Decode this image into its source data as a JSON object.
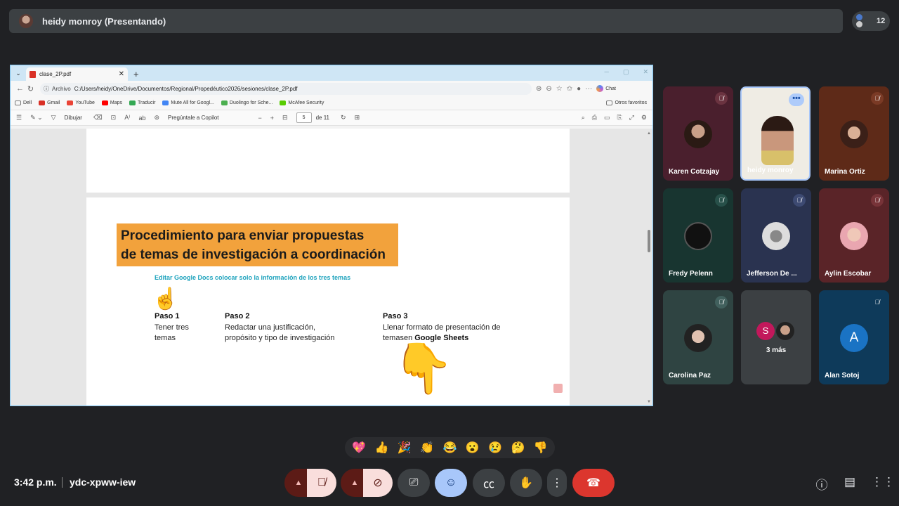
{
  "presenter": {
    "name": "heidy monroy (Presentando)",
    "participant_count": "12"
  },
  "browser": {
    "tab_title": "clase_2P.pdf",
    "address_label": "Archivo",
    "address_path": "C:/Users/heidy/OneDrive/Documentos/Regional/Propedéutico2026/sesiones/clase_2P.pdf",
    "chat_label": "Chat",
    "bookmarks": [
      "Dell",
      "Gmail",
      "YouTube",
      "Maps",
      "Traducir",
      "Mute All for Googl...",
      "Duolingo for Sche...",
      "McAfee Security"
    ],
    "bookmark_colors": [
      "#777777",
      "#d93025",
      "#ea4335",
      "#ff0000",
      "#34a853",
      "#4285f4",
      "#4caf50",
      "#58cc02",
      "#c01818"
    ],
    "other_bookmarks": "Otros favoritos",
    "toolbar": {
      "draw_label": "Dibujar",
      "copilot_label": "Pregúntale a Copilot",
      "page_current": "5",
      "page_total": "de 11"
    }
  },
  "slide": {
    "title_line1": "Procedimiento para enviar propuestas",
    "title_line2": "de temas de investigación a coordinación",
    "subtitle": "Editar Google Docs colocar solo la información de los tres temas",
    "paso1": {
      "heading": "Paso 1",
      "line1": "Tener tres",
      "line2": "temas"
    },
    "paso2": {
      "heading": "Paso 2",
      "line1": "Redactar una justificación,",
      "line2": "propósito y tipo de investigación"
    },
    "paso3": {
      "heading": "Paso 3",
      "line1": "Llenar formato de presentación de",
      "line2_prefix": "temasen ",
      "line2_bold": "Google Sheets"
    }
  },
  "participants": [
    {
      "name": "Karen Cotzajay",
      "bg": "#4a1f2d",
      "mic": "off"
    },
    {
      "name": "heidy monroy",
      "bg": "#f2f0ea",
      "mic": "on"
    },
    {
      "name": "Marina Ortiz",
      "bg": "#5e2a18",
      "mic": "off"
    },
    {
      "name": "Fredy Pelenn",
      "bg": "#183530",
      "mic": "off"
    },
    {
      "name": "Jefferson De ...",
      "bg": "#2a3350",
      "mic": "off"
    },
    {
      "name": "Aylin Escobar",
      "bg": "#5a2428",
      "mic": "off"
    },
    {
      "name": "Carolina Paz",
      "bg": "#2f4442",
      "mic": "off"
    },
    {
      "name": "3 más",
      "bg": "#3c4043",
      "mic": "none"
    },
    {
      "name": "Alan Sotoj",
      "bg": "#0e3a5a",
      "mic": "off"
    }
  ],
  "more_tile": {
    "initial": "S"
  },
  "alan_initial": "A",
  "reactions": [
    "💖",
    "👍",
    "🎉",
    "👏",
    "😂",
    "😮",
    "😢",
    "🤔",
    "👎"
  ],
  "meeting": {
    "time": "3:42 p.m.",
    "code": "ydc-xpww-iew"
  }
}
